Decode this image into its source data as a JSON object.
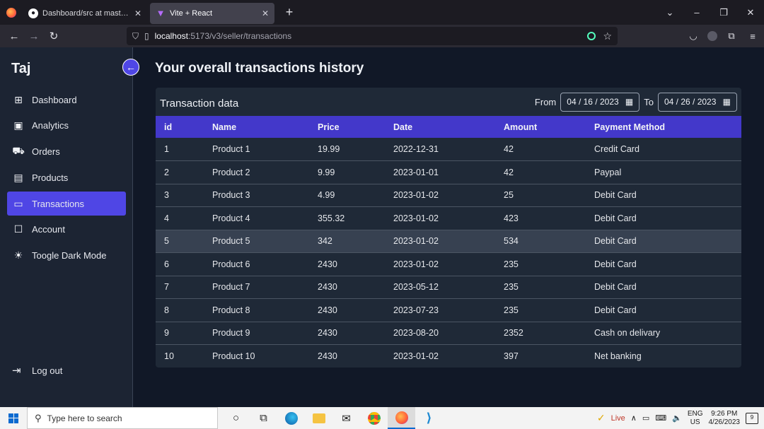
{
  "browser": {
    "tabs": [
      {
        "title": "Dashboard/src at master · Hayat",
        "icon": "github-icon",
        "active": false
      },
      {
        "title": "Vite + React",
        "icon": "vite-icon",
        "active": true
      }
    ],
    "url_host": "localhost",
    "url_path": ":5173/v3/seller/transactions"
  },
  "sidebar": {
    "brand": "Taj",
    "items": [
      {
        "label": "Dashboard",
        "icon": "dashboard-icon",
        "active": false
      },
      {
        "label": "Analytics",
        "icon": "analytics-icon",
        "active": false
      },
      {
        "label": "Orders",
        "icon": "cart-icon",
        "active": false
      },
      {
        "label": "Products",
        "icon": "products-icon",
        "active": false
      },
      {
        "label": "Transactions",
        "icon": "transactions-icon",
        "active": true
      },
      {
        "label": "Account",
        "icon": "account-icon",
        "active": false
      },
      {
        "label": "Toogle Dark Mode",
        "icon": "sun-icon",
        "active": false
      }
    ],
    "logout": "Log out"
  },
  "main": {
    "title": "Your overall transactions history",
    "card_title": "Transaction data",
    "from_label": "From",
    "to_label": "To",
    "from_date": "04 / 16 / 2023",
    "to_date": "04 / 26 / 2023",
    "columns": [
      "id",
      "Name",
      "Price",
      "Date",
      "Amount",
      "Payment Method"
    ],
    "rows": [
      [
        "1",
        "Product 1",
        "19.99",
        "2022-12-31",
        "42",
        "Credit Card"
      ],
      [
        "2",
        "Product 2",
        "9.99",
        "2023-01-01",
        "42",
        "Paypal"
      ],
      [
        "3",
        "Product 3",
        "4.99",
        "2023-01-02",
        "25",
        "Debit Card"
      ],
      [
        "4",
        "Product 4",
        "355.32",
        "2023-01-02",
        "423",
        "Debit Card"
      ],
      [
        "5",
        "Product 5",
        "342",
        "2023-01-02",
        "534",
        "Debit Card"
      ],
      [
        "6",
        "Product 6",
        "2430",
        "2023-01-02",
        "235",
        "Debit Card"
      ],
      [
        "7",
        "Product 7",
        "2430",
        "2023-05-12",
        "235",
        "Debit Card"
      ],
      [
        "8",
        "Product 8",
        "2430",
        "2023-07-23",
        "235",
        "Debit Card"
      ],
      [
        "9",
        "Product 9",
        "2430",
        "2023-08-20",
        "2352",
        "Cash on delivary"
      ],
      [
        "10",
        "Product 10",
        "2430",
        "2023-01-02",
        "397",
        "Net banking"
      ]
    ]
  },
  "taskbar": {
    "search_placeholder": "Type here to search",
    "weather": "Live",
    "lang_top": "ENG",
    "lang_bottom": "US",
    "time": "9:26 PM",
    "date": "4/26/2023",
    "notifications": "9"
  },
  "colors": {
    "accent": "#4f46e5",
    "table_header": "#4338ca",
    "background": "#111827",
    "card": "#1f2937"
  }
}
